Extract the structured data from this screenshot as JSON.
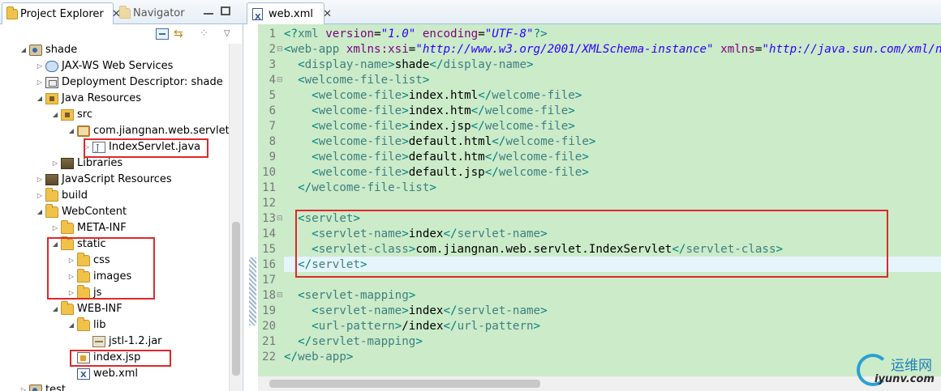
{
  "explorer": {
    "tabs": [
      {
        "label": "Project Explorer",
        "close": "✕"
      },
      {
        "label": "Navigator"
      }
    ],
    "tree": [
      {
        "id": "shade",
        "label": "shade",
        "icon": "project-icon",
        "twisty": "◢"
      },
      {
        "id": "jaxws",
        "label": "JAX-WS Web Services",
        "icon": "web-service-icon",
        "twisty": "▷"
      },
      {
        "id": "descriptor",
        "label": "Deployment Descriptor: shade",
        "icon": "descriptor-icon",
        "twisty": "▷"
      },
      {
        "id": "javares",
        "label": "Java Resources",
        "icon": "java-resources-icon",
        "twisty": "◢"
      },
      {
        "id": "src",
        "label": "src",
        "icon": "source-folder-icon",
        "twisty": "◢"
      },
      {
        "id": "pkg",
        "label": "com.jiangnan.web.servlet",
        "icon": "package-icon",
        "twisty": "◢"
      },
      {
        "id": "servletjava",
        "label": "IndexServlet.java",
        "icon": "java-file-icon",
        "twisty": "▷"
      },
      {
        "id": "libraries",
        "label": "Libraries",
        "icon": "library-icon",
        "twisty": "▷"
      },
      {
        "id": "jsres",
        "label": "JavaScript Resources",
        "icon": "javascript-resources-icon",
        "twisty": "▷"
      },
      {
        "id": "build",
        "label": "build",
        "icon": "folder-icon",
        "twisty": "▷"
      },
      {
        "id": "webcontent",
        "label": "WebContent",
        "icon": "folder-icon",
        "twisty": "◢"
      },
      {
        "id": "metainf",
        "label": "META-INF",
        "icon": "folder-icon",
        "twisty": "▷"
      },
      {
        "id": "static",
        "label": "static",
        "icon": "folder-icon",
        "twisty": "◢"
      },
      {
        "id": "css",
        "label": "css",
        "icon": "folder-icon",
        "twisty": "▷"
      },
      {
        "id": "images",
        "label": "images",
        "icon": "folder-icon",
        "twisty": "▷"
      },
      {
        "id": "js",
        "label": "js",
        "icon": "folder-icon",
        "twisty": "▷"
      },
      {
        "id": "webinf",
        "label": "WEB-INF",
        "icon": "folder-icon",
        "twisty": "◢"
      },
      {
        "id": "lib",
        "label": "lib",
        "icon": "folder-icon",
        "twisty": "◢"
      },
      {
        "id": "jstl",
        "label": "jstl-1.2.jar",
        "icon": "jar-file-icon",
        "twisty": ""
      },
      {
        "id": "indexjsp",
        "label": "index.jsp",
        "icon": "jsp-file-icon",
        "twisty": ""
      },
      {
        "id": "webxml",
        "label": "web.xml",
        "icon": "xml-file-icon",
        "twisty": ""
      },
      {
        "id": "test",
        "label": "test",
        "icon": "project-icon",
        "twisty": "▷"
      }
    ]
  },
  "editor": {
    "tab": {
      "label": "web.xml",
      "close": "✕"
    },
    "lines": [
      {
        "n": "1",
        "fold": "",
        "tokens": [
          [
            "b",
            "<?"
          ],
          [
            "t",
            "xml"
          ],
          [
            "x",
            " "
          ],
          [
            "a",
            "version"
          ],
          [
            "x",
            "="
          ],
          [
            "v",
            "\"1.0\""
          ],
          [
            "x",
            " "
          ],
          [
            "a",
            "encoding"
          ],
          [
            "x",
            "="
          ],
          [
            "v",
            "\"UTF-8\""
          ],
          [
            "b",
            "?>"
          ]
        ]
      },
      {
        "n": "2",
        "fold": "⊟",
        "tokens": [
          [
            "b",
            "<"
          ],
          [
            "t",
            "web-app"
          ],
          [
            "x",
            " "
          ],
          [
            "a",
            "xmlns:xsi"
          ],
          [
            "x",
            "="
          ],
          [
            "v",
            "\"http://www.w3.org/2001/XMLSchema-instance\""
          ],
          [
            "x",
            " "
          ],
          [
            "a",
            "xmlns"
          ],
          [
            "x",
            "="
          ],
          [
            "v",
            "\"http://java.sun.com/xml/ns/javaee\""
          ]
        ]
      },
      {
        "n": "3",
        "fold": "",
        "tokens": [
          [
            "x",
            "  "
          ],
          [
            "b",
            "<"
          ],
          [
            "t",
            "display-name"
          ],
          [
            "b",
            ">"
          ],
          [
            "x",
            "shade"
          ],
          [
            "b",
            "</"
          ],
          [
            "t",
            "display-name"
          ],
          [
            "b",
            ">"
          ]
        ]
      },
      {
        "n": "4",
        "fold": "⊟",
        "tokens": [
          [
            "x",
            "  "
          ],
          [
            "b",
            "<"
          ],
          [
            "t",
            "welcome-file-list"
          ],
          [
            "b",
            ">"
          ]
        ]
      },
      {
        "n": "5",
        "fold": "",
        "tokens": [
          [
            "x",
            "    "
          ],
          [
            "b",
            "<"
          ],
          [
            "t",
            "welcome-file"
          ],
          [
            "b",
            ">"
          ],
          [
            "x",
            "index.html"
          ],
          [
            "b",
            "</"
          ],
          [
            "t",
            "welcome-file"
          ],
          [
            "b",
            ">"
          ]
        ]
      },
      {
        "n": "6",
        "fold": "",
        "tokens": [
          [
            "x",
            "    "
          ],
          [
            "b",
            "<"
          ],
          [
            "t",
            "welcome-file"
          ],
          [
            "b",
            ">"
          ],
          [
            "x",
            "index.htm"
          ],
          [
            "b",
            "</"
          ],
          [
            "t",
            "welcome-file"
          ],
          [
            "b",
            ">"
          ]
        ]
      },
      {
        "n": "7",
        "fold": "",
        "tokens": [
          [
            "x",
            "    "
          ],
          [
            "b",
            "<"
          ],
          [
            "t",
            "welcome-file"
          ],
          [
            "b",
            ">"
          ],
          [
            "x",
            "index.jsp"
          ],
          [
            "b",
            "</"
          ],
          [
            "t",
            "welcome-file"
          ],
          [
            "b",
            ">"
          ]
        ]
      },
      {
        "n": "8",
        "fold": "",
        "tokens": [
          [
            "x",
            "    "
          ],
          [
            "b",
            "<"
          ],
          [
            "t",
            "welcome-file"
          ],
          [
            "b",
            ">"
          ],
          [
            "x",
            "default.html"
          ],
          [
            "b",
            "</"
          ],
          [
            "t",
            "welcome-file"
          ],
          [
            "b",
            ">"
          ]
        ]
      },
      {
        "n": "9",
        "fold": "",
        "tokens": [
          [
            "x",
            "    "
          ],
          [
            "b",
            "<"
          ],
          [
            "t",
            "welcome-file"
          ],
          [
            "b",
            ">"
          ],
          [
            "x",
            "default.htm"
          ],
          [
            "b",
            "</"
          ],
          [
            "t",
            "welcome-file"
          ],
          [
            "b",
            ">"
          ]
        ]
      },
      {
        "n": "10",
        "fold": "",
        "tokens": [
          [
            "x",
            "    "
          ],
          [
            "b",
            "<"
          ],
          [
            "t",
            "welcome-file"
          ],
          [
            "b",
            ">"
          ],
          [
            "x",
            "default.jsp"
          ],
          [
            "b",
            "</"
          ],
          [
            "t",
            "welcome-file"
          ],
          [
            "b",
            ">"
          ]
        ]
      },
      {
        "n": "11",
        "fold": "",
        "tokens": [
          [
            "x",
            "  "
          ],
          [
            "b",
            "</"
          ],
          [
            "t",
            "welcome-file-list"
          ],
          [
            "b",
            ">"
          ]
        ]
      },
      {
        "n": "12",
        "fold": "",
        "tokens": []
      },
      {
        "n": "13",
        "fold": "⊟",
        "tokens": [
          [
            "x",
            "  "
          ],
          [
            "b",
            "<"
          ],
          [
            "t",
            "servlet"
          ],
          [
            "b",
            ">"
          ]
        ]
      },
      {
        "n": "14",
        "fold": "",
        "tokens": [
          [
            "x",
            "    "
          ],
          [
            "b",
            "<"
          ],
          [
            "t",
            "servlet-name"
          ],
          [
            "b",
            ">"
          ],
          [
            "x",
            "index"
          ],
          [
            "b",
            "</"
          ],
          [
            "t",
            "servlet-name"
          ],
          [
            "b",
            ">"
          ]
        ]
      },
      {
        "n": "15",
        "fold": "",
        "tokens": [
          [
            "x",
            "    "
          ],
          [
            "b",
            "<"
          ],
          [
            "t",
            "servlet-class"
          ],
          [
            "b",
            ">"
          ],
          [
            "x",
            "com.jiangnan.web.servlet.IndexServlet"
          ],
          [
            "b",
            "</"
          ],
          [
            "t",
            "servlet-class"
          ],
          [
            "b",
            ">"
          ]
        ]
      },
      {
        "n": "16",
        "fold": "",
        "tokens": [
          [
            "x",
            "  "
          ],
          [
            "b",
            "</"
          ],
          [
            "t",
            "servlet"
          ],
          [
            "b",
            ">"
          ]
        ]
      },
      {
        "n": "17",
        "fold": "",
        "tokens": []
      },
      {
        "n": "18",
        "fold": "⊟",
        "tokens": [
          [
            "x",
            "  "
          ],
          [
            "b",
            "<"
          ],
          [
            "t",
            "servlet-mapping"
          ],
          [
            "b",
            ">"
          ]
        ]
      },
      {
        "n": "19",
        "fold": "",
        "tokens": [
          [
            "x",
            "    "
          ],
          [
            "b",
            "<"
          ],
          [
            "t",
            "servlet-name"
          ],
          [
            "b",
            ">"
          ],
          [
            "x",
            "index"
          ],
          [
            "b",
            "</"
          ],
          [
            "t",
            "servlet-name"
          ],
          [
            "b",
            ">"
          ]
        ]
      },
      {
        "n": "20",
        "fold": "",
        "tokens": [
          [
            "x",
            "    "
          ],
          [
            "b",
            "<"
          ],
          [
            "t",
            "url-pattern"
          ],
          [
            "b",
            ">"
          ],
          [
            "x",
            "/index"
          ],
          [
            "b",
            "</"
          ],
          [
            "t",
            "url-pattern"
          ],
          [
            "b",
            ">"
          ]
        ]
      },
      {
        "n": "21",
        "fold": "",
        "tokens": [
          [
            "x",
            "  "
          ],
          [
            "b",
            "</"
          ],
          [
            "t",
            "servlet-mapping"
          ],
          [
            "b",
            ">"
          ]
        ]
      },
      {
        "n": "22",
        "fold": "",
        "tokens": [
          [
            "b",
            "</"
          ],
          [
            "t",
            "web-app"
          ],
          [
            "b",
            ">"
          ]
        ]
      }
    ]
  },
  "colors": {
    "editor_bg": "#cbebc9",
    "current_line_bg": "#e6f4fb",
    "tag_bracket": "#008080",
    "tag_name": "#3f7f7f",
    "attribute": "#7f007f",
    "attribute_value": "#2a00ff",
    "highlight_box": "#e0282a"
  },
  "watermark": {
    "title": "运维网",
    "url": "iyunv.com"
  }
}
